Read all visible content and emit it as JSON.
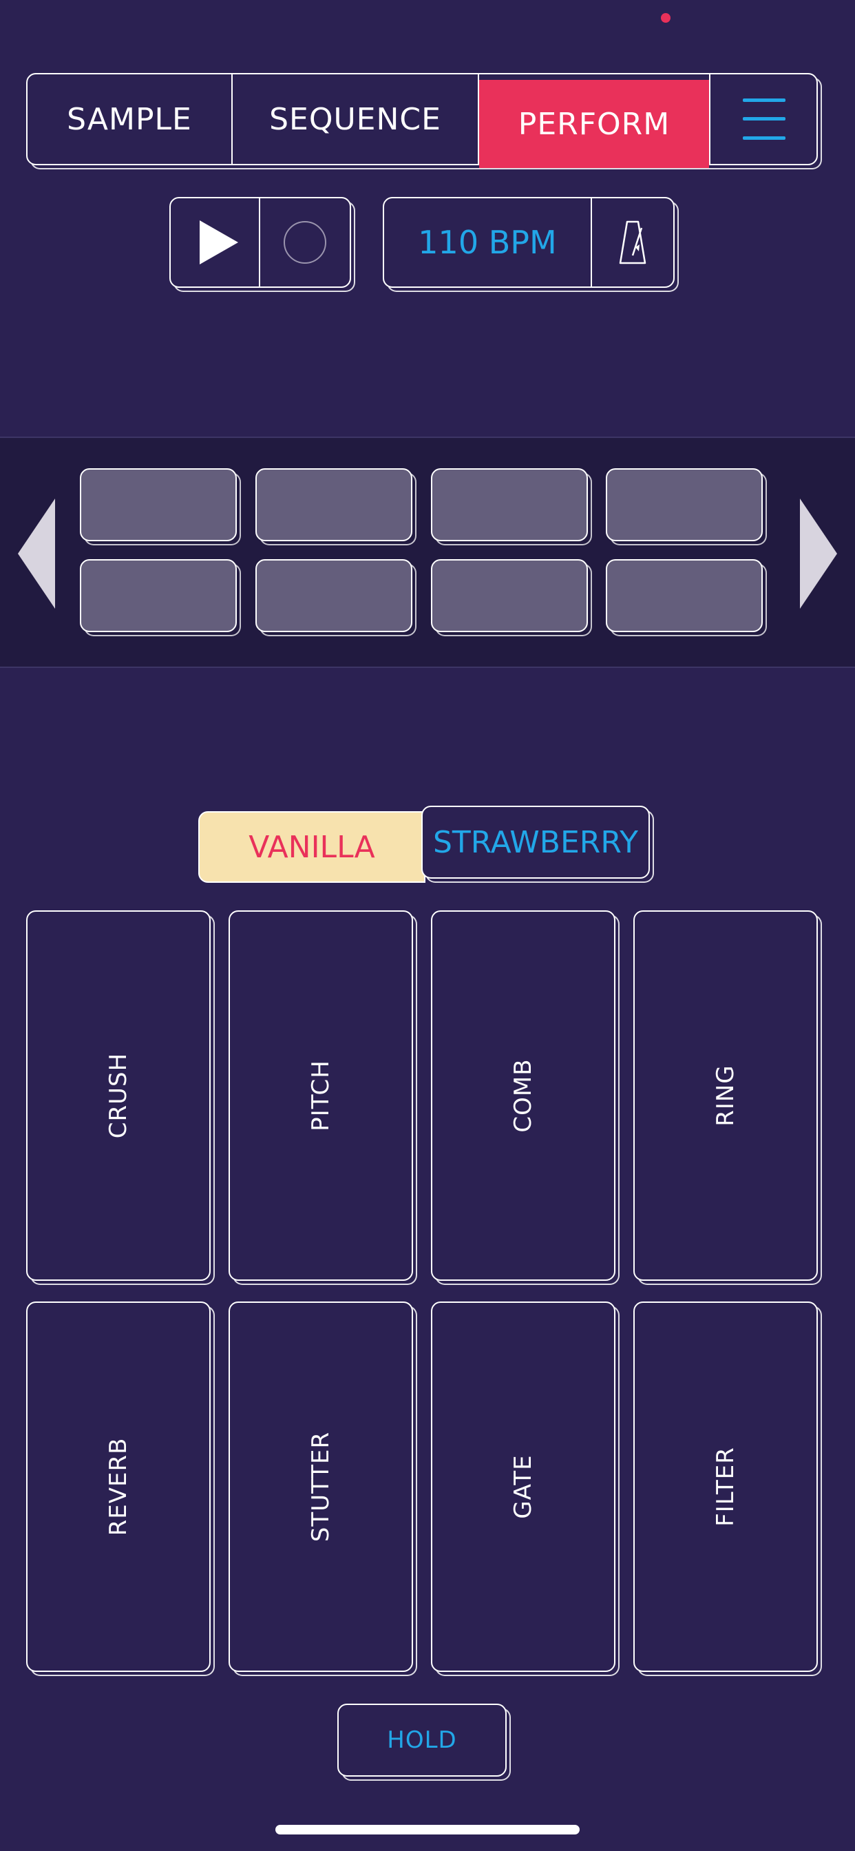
{
  "tabs": {
    "sample": "SAMPLE",
    "sequence": "SEQUENCE",
    "perform": "PERFORM",
    "active": "perform"
  },
  "transport": {
    "bpm_label": "110 BPM"
  },
  "icons": {
    "menu": "hamburger-icon",
    "play": "play-icon",
    "record": "record-icon",
    "metronome": "metronome-icon",
    "prev": "triangle-left-icon",
    "next": "triangle-right-icon"
  },
  "flavors": {
    "vanilla": "VANILLA",
    "strawberry": "STRAWBERRY",
    "selected": "vanilla"
  },
  "effects": [
    "CRUSH",
    "PITCH",
    "COMB",
    "RING",
    "REVERB",
    "STUTTER",
    "GATE",
    "FILTER"
  ],
  "hold_label": "HOLD",
  "colors": {
    "background": "#2b2152",
    "accent_red": "#e9315a",
    "accent_blue": "#22a7e8",
    "vanilla_bg": "#f7e2ae",
    "slot_fill": "#645e7c"
  }
}
